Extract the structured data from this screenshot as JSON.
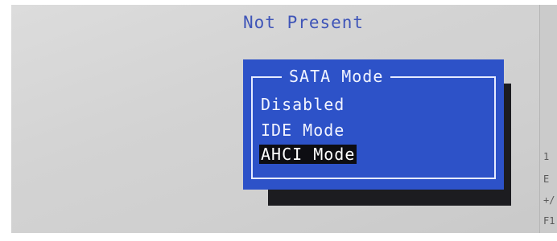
{
  "status_value": "Not Present",
  "popup": {
    "title": "SATA Mode",
    "options": [
      "Disabled",
      "IDE Mode",
      "AHCI Mode"
    ],
    "selected": "AHCI Mode"
  },
  "help_panel": {
    "lines": [
      "",
      "1",
      "E",
      "+/",
      "F1"
    ]
  },
  "colors": {
    "popup_background": "#2d52c8",
    "popup_shadow": "#1c1c20",
    "selection_background": "#0d0d12",
    "value_text": "#3f55b8"
  }
}
